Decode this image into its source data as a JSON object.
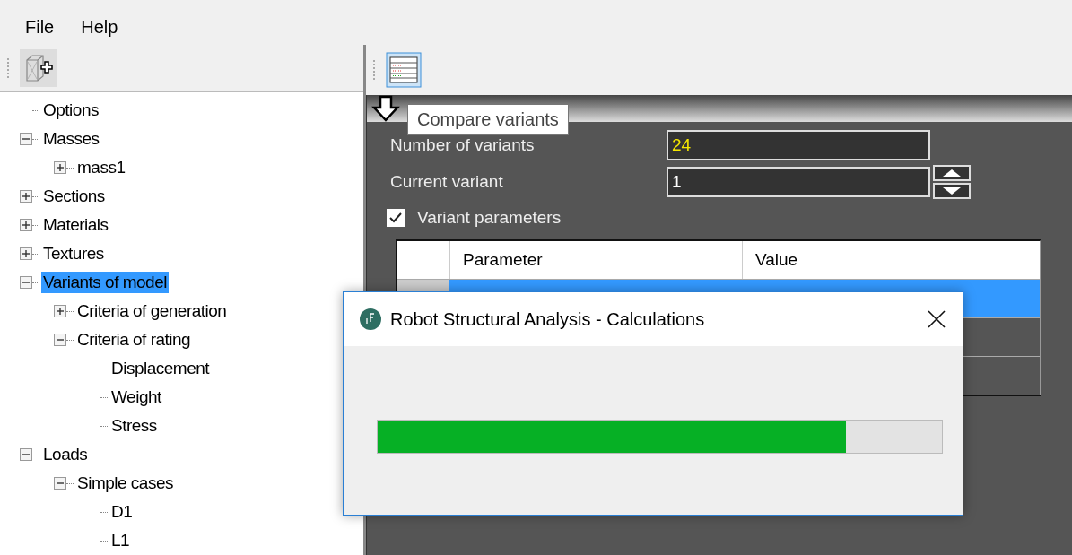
{
  "menu": [
    "File",
    "Help"
  ],
  "tree": [
    {
      "label": "Options"
    },
    {
      "label": "Masses",
      "expanded": true,
      "children": [
        {
          "label": "mass1",
          "expanded": false
        }
      ]
    },
    {
      "label": "Sections",
      "expanded": false
    },
    {
      "label": "Materials",
      "expanded": false
    },
    {
      "label": "Textures",
      "expanded": false
    },
    {
      "label": "Variants of model",
      "expanded": true,
      "selected": true,
      "children": [
        {
          "label": "Criteria of generation",
          "expanded": false
        },
        {
          "label": "Criteria of rating",
          "expanded": true,
          "children": [
            {
              "label": "Displacement"
            },
            {
              "label": "Weight"
            },
            {
              "label": "Stress"
            }
          ]
        }
      ]
    },
    {
      "label": "Loads",
      "expanded": true,
      "children": [
        {
          "label": "Simple cases",
          "expanded": true,
          "children": [
            {
              "label": "D1"
            },
            {
              "label": "L1"
            }
          ]
        }
      ]
    }
  ],
  "tooltip": "Compare variants",
  "fields": [
    {
      "label": "Number of variants",
      "value": "24",
      "highlight": true
    },
    {
      "label": "Current variant",
      "value": "1",
      "highlight": false,
      "spinner": true
    }
  ],
  "variant_parameters": {
    "label": "Variant parameters",
    "checked": true
  },
  "table": {
    "columns": [
      "Parameter",
      "Value"
    ],
    "rows": [
      {
        "selected": true
      },
      {
        "selected": false
      },
      {
        "selected": false
      }
    ]
  },
  "dialog": {
    "title": "Robot Structural Analysis - Calculations",
    "progress": {
      "level": 0.83
    }
  }
}
